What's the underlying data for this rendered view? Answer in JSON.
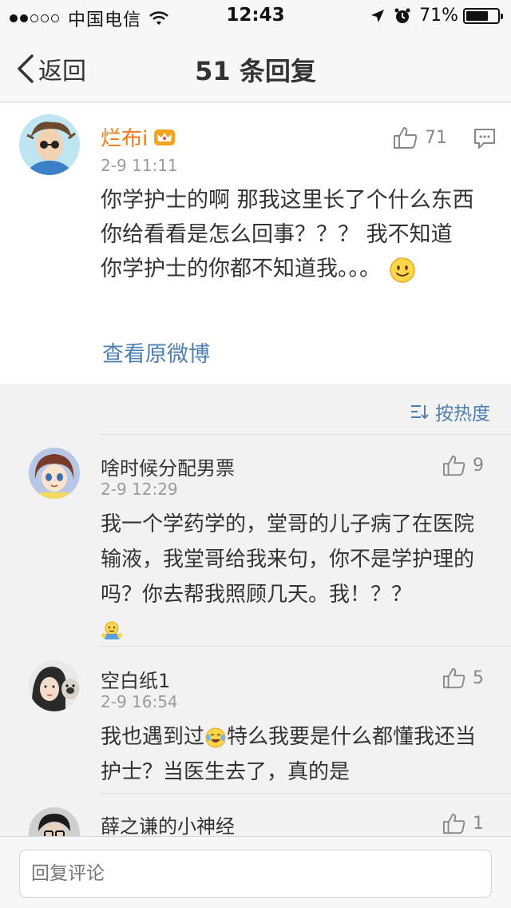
{
  "status_bar": {
    "carrier": "中国电信",
    "time": "12:43",
    "battery": "71%",
    "battery_level": 0.71
  },
  "nav": {
    "back_label": "返回",
    "title": "51 条回复"
  },
  "post": {
    "username": "烂布i",
    "time": "2-9 11:11",
    "likes": "71",
    "text": "你学护士的啊 那我这里长了个什么东西你给看看是怎么回事？？？ 我不知道　你学护士的你都不知道我。。。",
    "view_original": "查看原微博"
  },
  "sort": {
    "label": "按热度"
  },
  "replies": [
    {
      "username": "啥时候分配男票",
      "time": "2-9 12:29",
      "likes": "9",
      "text": "我一个学药学的，堂哥的儿子病了在医院输液，我堂哥给我来句，你不是学护理的吗？你去帮我照顾几天。我！？？"
    },
    {
      "username": "空白纸1",
      "time": "2-9 16:54",
      "likes": "5",
      "text_before": "我也遇到过",
      "text_after": "特么我要是什么都懂我还当护士？当医生去了，真的是"
    },
    {
      "username": "薛之谦的小神经",
      "likes": "1"
    }
  ],
  "input": {
    "placeholder": "回复评论"
  },
  "colors": {
    "username_vip": "#f57a15",
    "link": "#4d7fb4",
    "muted": "#9a9a9a"
  }
}
